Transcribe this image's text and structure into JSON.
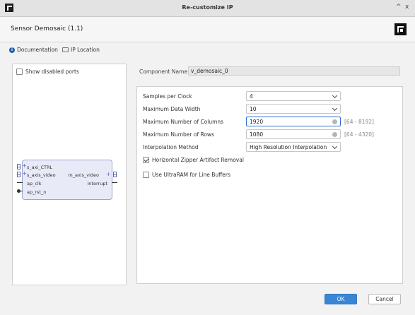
{
  "window": {
    "title": "Re-customize IP",
    "minimize": "^",
    "close": "x"
  },
  "header": {
    "ip_name": "Sensor Demosaic (1.1)"
  },
  "links": {
    "documentation": "Documentation",
    "ip_location": "IP Location"
  },
  "left_panel": {
    "show_disabled_ports": {
      "label": "Show disabled ports",
      "checked": false
    },
    "block": {
      "left_ports": [
        "s_axi_CTRL",
        "s_axis_video",
        "ap_clk",
        "ap_rst_n"
      ],
      "right_ports": [
        "m_axis_video",
        "interrupt"
      ]
    }
  },
  "component": {
    "label": "Component Name",
    "value": "v_demosaic_0"
  },
  "params": {
    "samples_per_clock": {
      "label": "Samples per Clock",
      "value": "4"
    },
    "max_data_width": {
      "label": "Maximum Data Width",
      "value": "10"
    },
    "max_columns": {
      "label": "Maximum Number of Columns",
      "value": "1920",
      "range": "[64 - 8192]"
    },
    "max_rows": {
      "label": "Maximum Number of Rows",
      "value": "1080",
      "range": "[64 - 4320]"
    },
    "interpolation": {
      "label": "Interpolation Method",
      "value": "High Resolution Interpolation"
    },
    "zipper_removal": {
      "label": "Horizontal Zipper Artifact Removal",
      "checked": true
    },
    "ultraram": {
      "label": "Use UltraRAM for Line Buffers",
      "checked": false
    }
  },
  "buttons": {
    "ok": "OK",
    "cancel": "Cancel"
  }
}
